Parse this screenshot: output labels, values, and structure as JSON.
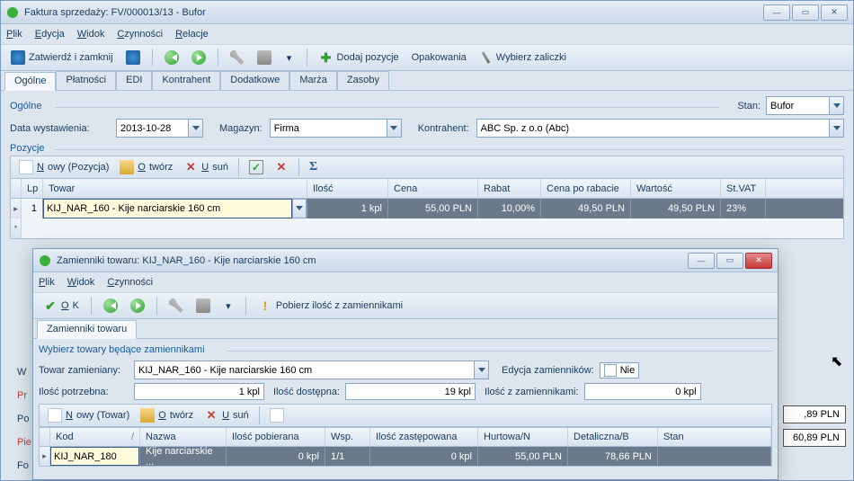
{
  "main": {
    "title": "Faktura sprzedaży: FV/000013/13 - Bufor",
    "menu": {
      "plik": "Plik",
      "edycja": "Edycja",
      "widok": "Widok",
      "czynnosci": "Czynności",
      "relacje": "Relacje"
    },
    "toolbar": {
      "save_close": "Zatwierdź i zamknij",
      "add_pos": "Dodaj pozycje",
      "pack": "Opakowania",
      "advances": "Wybierz zaliczki"
    },
    "tabs": [
      "Ogólne",
      "Płatności",
      "EDI",
      "Kontrahent",
      "Dodatkowe",
      "Marża",
      "Zasoby"
    ],
    "section_ogolne": "Ogólne",
    "section_pozycje": "Pozycje",
    "stan_lbl": "Stan:",
    "stan_val": "Bufor",
    "date_lbl": "Data wystawienia:",
    "date_val": "2013-10-28",
    "mag_lbl": "Magazyn:",
    "mag_val": "Firma",
    "kon_lbl": "Kontrahent:",
    "kon_val": "ABC Sp. z o.o (Abc)",
    "grid_toolbar": {
      "nowy": "Nowy (Pozycja)",
      "otworz": "Otwórz",
      "usun": "Usuń"
    },
    "grid_head": {
      "lp": "Lp",
      "towar": "Towar",
      "ilosc": "Ilość",
      "cena": "Cena",
      "rabat": "Rabat",
      "cena_po": "Cena po rabacie",
      "wartosc": "Wartość",
      "vat": "St.VAT"
    },
    "grid_row": {
      "lp": "1",
      "towar": "KIJ_NAR_160 - Kije narciarskie 160 cm",
      "ilosc": "1 kpl",
      "cena": "55,00 PLN",
      "rabat": "10,00%",
      "cena_po": "49,50 PLN",
      "wartosc": "49,50 PLN",
      "vat": "23%"
    },
    "side": {
      "w": "W",
      "pr": "Pr",
      "po": "Po",
      "pie": "Pie",
      "fo": "Fo"
    },
    "vals": {
      "v1": ",89 PLN",
      "v2": "60,89 PLN"
    }
  },
  "sub": {
    "title": "Zamienniki towaru: KIJ_NAR_160 - Kije narciarskie 160 cm",
    "menu": {
      "plik": "Plik",
      "widok": "Widok",
      "czynnosci": "Czynności"
    },
    "toolbar": {
      "ok": "OK",
      "pobierz": "Pobierz ilość z zamiennikami"
    },
    "tab": "Zamienniki towaru",
    "section": "Wybierz towary będące zamiennikami",
    "towar_lbl": "Towar zamieniany:",
    "towar_val": "KIJ_NAR_160 - Kije narciarskie 160 cm",
    "edycja_lbl": "Edycja zamienników:",
    "edycja_val": "Nie",
    "potrz_lbl": "Ilość potrzebna:",
    "potrz_val": "1 kpl",
    "dost_lbl": "Ilość dostępna:",
    "dost_val": "19 kpl",
    "zam_lbl": "Ilość z zamiennikami:",
    "zam_val": "0 kpl",
    "grid_toolbar": {
      "nowy": "Nowy (Towar)",
      "otworz": "Otwórz",
      "usun": "Usuń"
    },
    "grid_head": {
      "kod": "Kod",
      "nazwa": "Nazwa",
      "ilosc_pob": "Ilość pobierana",
      "wsp": "Wsp.",
      "ilosc_zast": "Ilość zastępowana",
      "hurt": "Hurtowa/N",
      "detal": "Detaliczna/B",
      "stan": "Stan"
    },
    "grid_row": {
      "kod": "KIJ_NAR_180",
      "nazwa": "Kije narciarskie ...",
      "ilosc_pob": "0 kpl",
      "wsp": "1/1",
      "ilosc_zast": "0 kpl",
      "hurt": "55,00 PLN",
      "detal": "78,66 PLN",
      "stan": ""
    }
  }
}
